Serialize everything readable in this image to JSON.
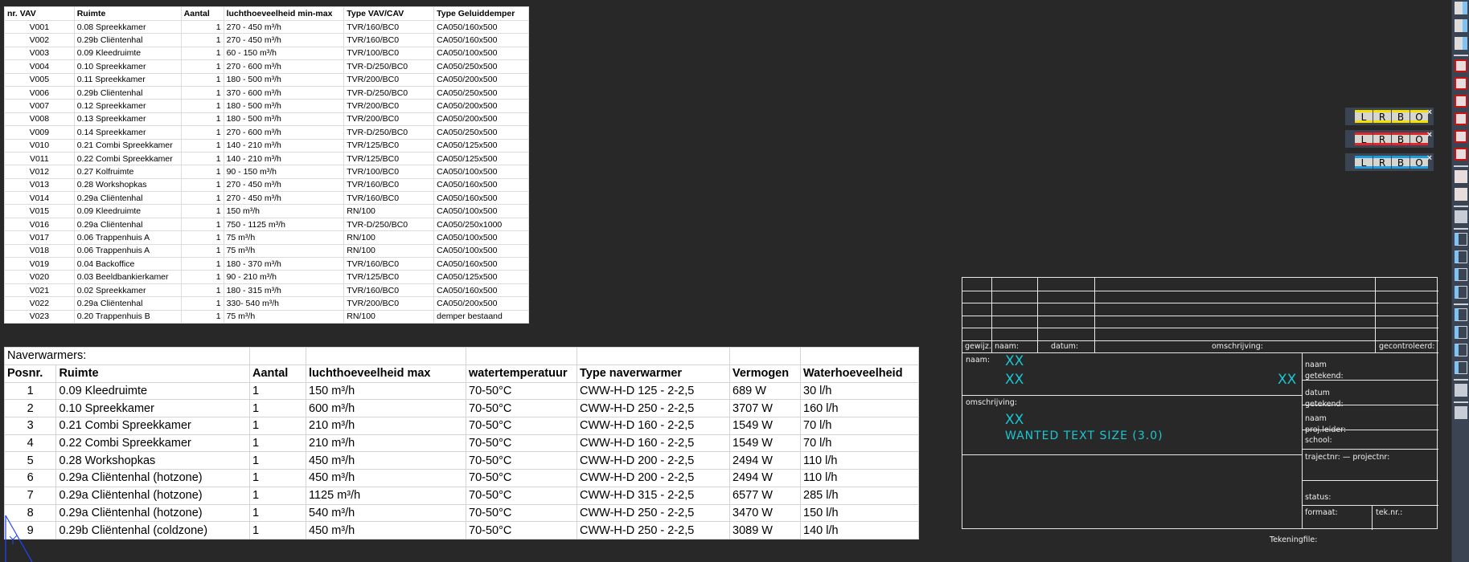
{
  "vav_table": {
    "headers": [
      "nr. VAV",
      "Ruimte",
      "Aantal",
      "luchthoeveelheid min-max",
      "Type VAV/CAV",
      "Type Geluiddemper"
    ],
    "rows": [
      [
        "V001",
        "0.08 Spreekkamer",
        "1",
        "270 - 450 m³/h",
        "TVR/160/BC0",
        "CA050/160x500"
      ],
      [
        "V002",
        "0.29b Cliëntenhal",
        "1",
        "270 - 450 m³/h",
        "TVR/160/BC0",
        "CA050/160x500"
      ],
      [
        "V003",
        "0.09 Kleedruimte",
        "1",
        "60 - 150 m³/h",
        "TVR/100/BC0",
        "CA050/100x500"
      ],
      [
        "V004",
        "0.10 Spreekkamer",
        "1",
        "270 - 600 m³/h",
        "TVR-D/250/BC0",
        "CA050/250x500"
      ],
      [
        "V005",
        "0.11 Spreekkamer",
        "1",
        "180 - 500 m³/h",
        "TVR/200/BC0",
        "CA050/200x500"
      ],
      [
        "V006",
        "0.29b Cliëntenhal",
        "1",
        "370 - 600 m³/h",
        "TVR-D/250/BC0",
        "CA050/250x500"
      ],
      [
        "V007",
        "0.12 Spreekkamer",
        "1",
        "180 - 500 m³/h",
        "TVR/200/BC0",
        "CA050/200x500"
      ],
      [
        "V008",
        "0.13 Spreekkamer",
        "1",
        "180 - 500 m³/h",
        "TVR/200/BC0",
        "CA050/200x500"
      ],
      [
        "V009",
        "0.14 Spreekkamer",
        "1",
        "270 - 600 m³/h",
        "TVR-D/250/BC0",
        "CA050/250x500"
      ],
      [
        "V010",
        "0.21 Combi Spreekkamer",
        "1",
        "140 - 210 m³/h",
        "TVR/125/BC0",
        "CA050/125x500"
      ],
      [
        "V011",
        "0.22 Combi Spreekkamer",
        "1",
        "140 - 210 m³/h",
        "TVR/125/BC0",
        "CA050/125x500"
      ],
      [
        "V012",
        "0.27 Kolfruimte",
        "1",
        "90 - 150 m³/h",
        "TVR/100/BC0",
        "CA050/100x500"
      ],
      [
        "V013",
        "0.28 Workshopkas",
        "1",
        "270 - 450 m³/h",
        "TVR/160/BC0",
        "CA050/160x500"
      ],
      [
        "V014",
        "0.29a Cliëntenhal",
        "1",
        "270 - 450 m³/h",
        "TVR/160/BC0",
        "CA050/160x500"
      ],
      [
        "V015",
        "0.09 Kleedruimte",
        "1",
        "150 m³/h",
        "RN/100",
        "CA050/100x500"
      ],
      [
        "V016",
        "0.29a Cliëntenhal",
        "1",
        "750 - 1125 m³/h",
        "TVR-D/250/BC0",
        "CA050/250x1000"
      ],
      [
        "V017",
        "0.06 Trappenhuis A",
        "1",
        "75 m³/h",
        "RN/100",
        "CA050/100x500"
      ],
      [
        "V018",
        "0.06 Trappenhuis A",
        "1",
        "75 m³/h",
        "RN/100",
        "CA050/100x500"
      ],
      [
        "V019",
        "0.04 Backoffice",
        "1",
        "180 - 370 m³/h",
        "TVR/160/BC0",
        "CA050/160x500"
      ],
      [
        "V020",
        "0.03 Beeldbankierkamer",
        "1",
        "90 - 210 m³/h",
        "TVR/125/BC0",
        "CA050/125x500"
      ],
      [
        "V021",
        "0.02 Spreekkamer",
        "1",
        "180 - 315 m³/h",
        "TVR/160/BC0",
        "CA050/160x500"
      ],
      [
        "V022",
        "0.29a Cliëntenhal",
        "1",
        "330- 540 m³/h",
        "TVR/200/BC0",
        "CA050/200x500"
      ],
      [
        "V023",
        "0.20 Trappenhuis B",
        "1",
        "75 m³/h",
        "RN/100",
        "demper bestaand"
      ]
    ]
  },
  "naverwarmers_table": {
    "title": "Naverwarmers:",
    "headers": [
      "Posnr.",
      "Ruimte",
      "Aantal",
      "luchthoeveelheid max",
      "watertemperatuur",
      "Type naverwarmer",
      "Vermogen",
      "Waterhoeveelheid"
    ],
    "rows": [
      [
        "1",
        "0.09 Kleedruimte",
        "1",
        "150 m³/h",
        "70-50°C",
        "CWW-H-D 125 - 2-2,5",
        "689 W",
        "30 l/h"
      ],
      [
        "2",
        "0.10 Spreekkamer",
        "1",
        "600 m³/h",
        "70-50°C",
        "CWW-H-D 250 - 2-2,5",
        "3707 W",
        "160 l/h"
      ],
      [
        "3",
        "0.21 Combi Spreekkamer",
        "1",
        "210 m³/h",
        "70-50°C",
        "CWW-H-D 160 - 2-2,5",
        "1549 W",
        "70 l/h"
      ],
      [
        "4",
        "0.22 Combi Spreekkamer",
        "1",
        "210 m³/h",
        "70-50°C",
        "CWW-H-D 160 - 2-2,5",
        "1549 W",
        "70 l/h"
      ],
      [
        "5",
        "0.28 Workshopkas",
        "1",
        "450 m³/h",
        "70-50°C",
        "CWW-H-D 200 - 2-2,5",
        "2494 W",
        "110 l/h"
      ],
      [
        "6",
        "0.29a Cliëntenhal (hotzone)",
        "1",
        "450 m³/h",
        "70-50°C",
        "CWW-H-D 200 - 2-2,5",
        "2494 W",
        "110 l/h"
      ],
      [
        "7",
        "0.29a Cliëntenhal (hotzone)",
        "1",
        "1125 m³/h",
        "70-50°C",
        "CWW-H-D 315 - 2-2,5",
        "6577 W",
        "285 l/h"
      ],
      [
        "8",
        "0.29a Cliëntenhal (hotzone)",
        "1",
        "540 m³/h",
        "70-50°C",
        "CWW-H-D 250 - 2-2,5",
        "3470 W",
        "150 l/h"
      ],
      [
        "9",
        "0.29b Cliëntenhal (coldzone)",
        "1",
        "450 m³/h",
        "70-50°C",
        "CWW-H-D 250 - 2-2,5",
        "3089 W",
        "140 l/h"
      ]
    ]
  },
  "title_block": {
    "revision_headers": [
      "gewijz.",
      "naam:",
      "datum:",
      "omschrijving:",
      "gecontroleerd:"
    ],
    "naam_label": "naam:",
    "xx": "XX",
    "omschrijving_label": "omschrijving:",
    "wanted": "WANTED TEXT SIZE (3.0)",
    "naam_getekend": [
      "naam",
      "getekend:"
    ],
    "datum_getekend": [
      "datum",
      "getekend:"
    ],
    "naam_projleider": [
      "naam",
      "proj.leider:"
    ],
    "school": "school:",
    "trajectnr": "trajectnr:  —  projectnr:",
    "status": "status:",
    "formaat": "formaat:",
    "teknr": "tek.nr.:",
    "tekeningfile": "Tekeningfile:"
  },
  "layer_panels": [
    {
      "buttons": [
        "L",
        "R",
        "B",
        "O"
      ],
      "color": "#f5e100",
      "close": "×"
    },
    {
      "buttons": [
        "L",
        "R",
        "B",
        "O"
      ],
      "color": "#e0262a",
      "close": "×"
    },
    {
      "buttons": [
        "L",
        "R",
        "B",
        "O"
      ],
      "color": "#1e9ee0",
      "close": "×"
    }
  ],
  "toolbar_icons": [
    "layer-tool-icon",
    "layer-tool-icon",
    "layer-match-icon",
    "view-front-icon",
    "view-top-icon",
    "view-bottom-icon",
    "view-left-icon",
    "view-right-icon",
    "view-back-icon",
    "ucs-icon",
    "ucs-icon",
    "named-views-icon",
    "cube-top-icon",
    "cube-front-icon",
    "cube-left-icon",
    "cube-right-icon",
    "iso-sw-icon",
    "iso-se-icon",
    "iso-ne-icon",
    "iso-nw-icon",
    "camera-icon",
    "zoom-extents-icon"
  ],
  "colors": {
    "canvas": "#282828",
    "cad_text": "#19c8d2",
    "toolbar": "#3b4453"
  }
}
